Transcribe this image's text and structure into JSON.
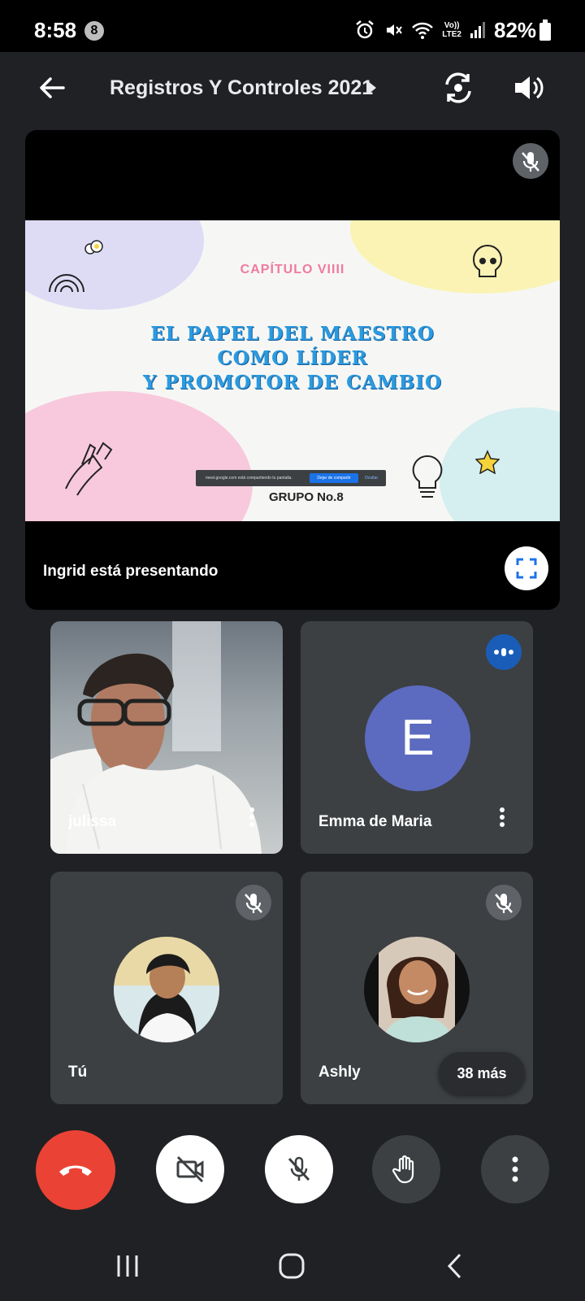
{
  "status_bar": {
    "time": "8:58",
    "notification_count": "8",
    "network_label_top": "Vo))",
    "network_label_bottom": "LTE2",
    "battery": "82%"
  },
  "app_bar": {
    "title": "Registros Y Controles 2021",
    "icons": [
      "back-arrow-icon",
      "switch-camera-icon",
      "speaker-icon"
    ]
  },
  "presentation": {
    "slide": {
      "chapter": "CAPÍTULO VIIII",
      "title_lines": [
        "EL PAPEL DEL MAESTRO",
        "COMO LÍDER",
        "Y PROMOTOR DE CAMBIO"
      ],
      "group": "GRUPO No.8",
      "share_banner": {
        "text": "meet.google.com está compartiendo tu pantalla.",
        "stop_label": "Dejar de compartir",
        "hide_label": "Ocultar"
      }
    },
    "presenter_text": "Ingrid está presentando"
  },
  "participants": [
    {
      "name": "julissa",
      "type": "video",
      "muted": false
    },
    {
      "name": "Emma de Maria",
      "type": "letter",
      "initial": "E",
      "speaking": true,
      "avatar_color": "#5c6bc0"
    },
    {
      "name": "Tú",
      "type": "photo",
      "muted": true
    },
    {
      "name": "Ashly",
      "type": "photo",
      "muted": true
    }
  ],
  "more_participants": "38 más",
  "controls": [
    "end-call",
    "camera-off",
    "mic-off",
    "raise-hand",
    "more-options"
  ],
  "colors": {
    "background": "#202124",
    "tile": "#3c4043",
    "end_call": "#ea4335",
    "speaking": "#1a5db8"
  }
}
